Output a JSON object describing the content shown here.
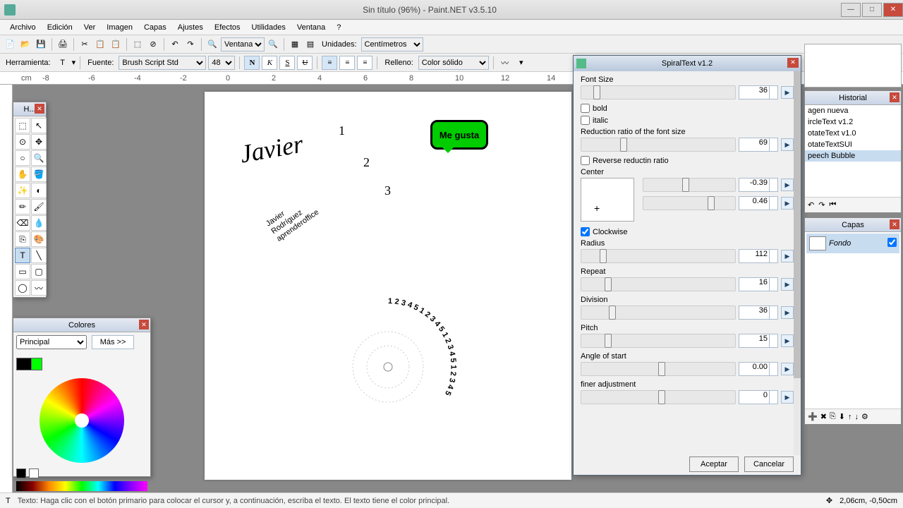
{
  "app": {
    "title": "Sin título (96%) - Paint.NET v3.5.10"
  },
  "menu": {
    "archivo": "Archivo",
    "edicion": "Edición",
    "ver": "Ver",
    "imagen": "Imagen",
    "capas": "Capas",
    "ajustes": "Ajustes",
    "efectos": "Efectos",
    "utilidades": "Utilidades",
    "ventana": "Ventana",
    "help": "?"
  },
  "toolbar1": {
    "units_label": "Unidades:",
    "units_value": "Centímetros",
    "zoom_value": "Ventana"
  },
  "toolbar2": {
    "herramienta": "Herramienta:",
    "fuente": "Fuente:",
    "font_name": "Brush Script Std",
    "font_size": "48",
    "relleno": "Relleno:",
    "fill_value": "Color sólido",
    "n": "N",
    "k": "K",
    "s": "S",
    "u": "U"
  },
  "tools_title": "H...",
  "colors": {
    "title": "Colores",
    "selector": "Principal",
    "mas": "Más >>"
  },
  "spiral": {
    "title": "SpiralText v1.2",
    "font_size_label": "Font Size",
    "font_size": "36",
    "bold": "bold",
    "italic": "italic",
    "reduction_label": "Reduction ratio of the font size",
    "reduction": "69",
    "reverse": "Reverse reductin ratio",
    "center": "Center",
    "center_x": "-0.39",
    "center_y": "0.46",
    "clockwise": "Clockwise",
    "radius_label": "Radius",
    "radius": "112",
    "repeat_label": "Repeat",
    "repeat": "16",
    "division_label": "Division",
    "division": "36",
    "pitch_label": "Pitch",
    "pitch": "15",
    "angle_label": "Angle of start",
    "angle": "0.00",
    "finer_label": "finer adjustment",
    "finer": "0",
    "aceptar": "Aceptar",
    "cancelar": "Cancelar"
  },
  "history": {
    "title": "Historial",
    "items": [
      "agen nueva",
      "ircleText v1.2",
      "otateText v1.0",
      "otateTextSUI",
      "peech Bubble"
    ]
  },
  "layers": {
    "title": "Capas",
    "bg": "Fondo"
  },
  "status": {
    "msg": "Texto: Haga clic con el botón primario para colocar el cursor y, a continuación, escriba el texto. El texto tiene el color principal.",
    "coords": "2,06cm, -0,50cm"
  },
  "canvas": {
    "bubble": "Me gusta",
    "javier": "Javier",
    "diag1": "Javier",
    "diag2": "Rodríguez",
    "diag3": "aprenderoffice",
    "n1": "1",
    "n2": "2",
    "n3": "3"
  }
}
